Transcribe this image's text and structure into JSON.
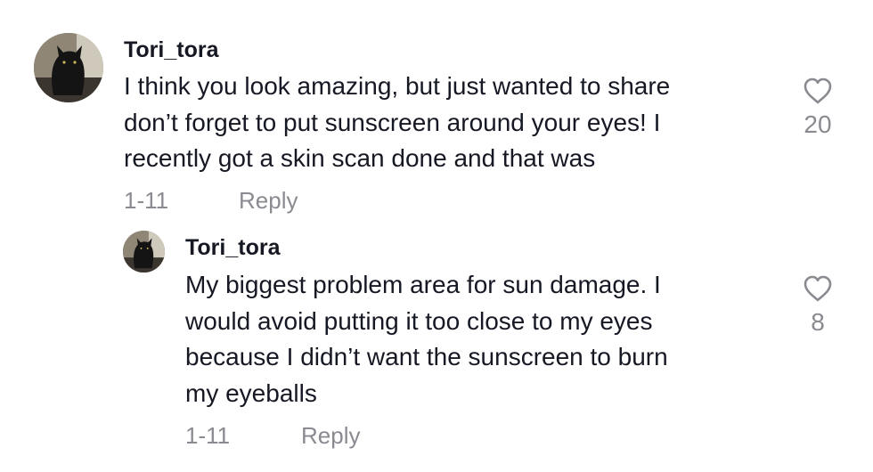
{
  "comments": [
    {
      "username": "Tori_tora",
      "text_lines": [
        "I think you look amazing, but just wanted to share",
        "don’t forget to put sunscreen around your eyes! I",
        "recently got a skin scan done and that was"
      ],
      "date": "1-11",
      "reply_label": "Reply",
      "likes": "20",
      "like_icon": "heart-outline-icon"
    }
  ],
  "replies": [
    {
      "username": "Tori_tora",
      "text_lines": [
        "My biggest problem area for sun damage. I",
        "would avoid putting it too close to my eyes",
        "because I didn’t want the sunscreen to burn",
        "my eyeballs"
      ],
      "date": "1-11",
      "reply_label": "Reply",
      "likes": "8",
      "like_icon": "heart-outline-icon"
    }
  ],
  "colors": {
    "primary_text": "#161823",
    "secondary_text": "#8a8b91"
  }
}
